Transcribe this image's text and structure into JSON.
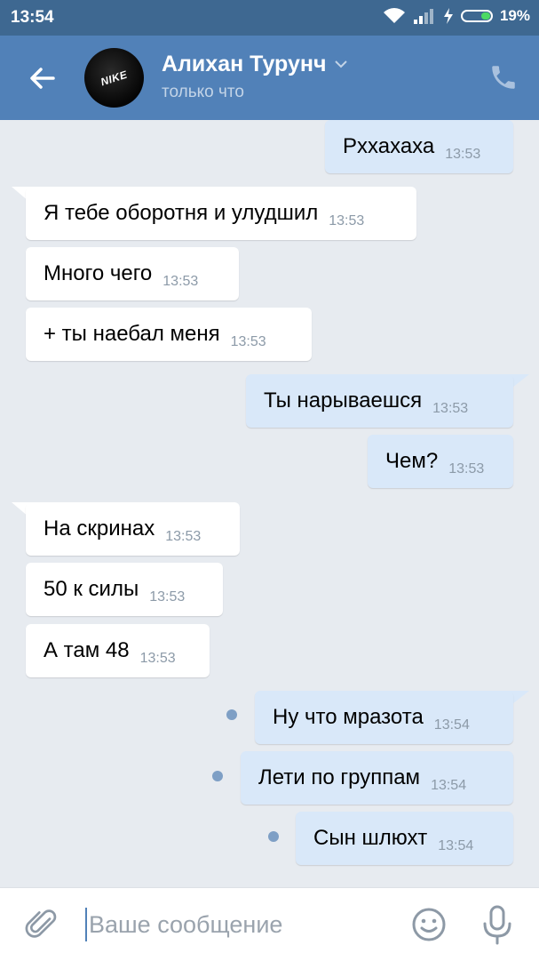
{
  "status_bar": {
    "time": "13:54",
    "battery": "19%"
  },
  "header": {
    "back_icon": "arrow-left-icon",
    "avatar_logo": "NIKE",
    "name": "Алихан Турунч",
    "status": "только что",
    "call_icon": "phone-icon"
  },
  "messages": [
    {
      "dir": "out",
      "text": "Рххахаха",
      "time": "13:53"
    },
    {
      "dir": "in",
      "text": "Я тебе оборотня и улудшил",
      "time": "13:53"
    },
    {
      "dir": "in",
      "text": "Много чего",
      "time": "13:53"
    },
    {
      "dir": "in",
      "text": "+ ты наебал меня",
      "time": "13:53"
    },
    {
      "dir": "out",
      "text": "Ты нарываешся",
      "time": "13:53"
    },
    {
      "dir": "out",
      "text": "Чем?",
      "time": "13:53"
    },
    {
      "dir": "in",
      "text": "На скринах",
      "time": "13:53"
    },
    {
      "dir": "in",
      "text": "50 к силы",
      "time": "13:53"
    },
    {
      "dir": "in",
      "text": "А там 48",
      "time": "13:53"
    },
    {
      "dir": "out",
      "text": "Ну что мразота",
      "time": "13:54",
      "unread": true
    },
    {
      "dir": "out",
      "text": "Лети по группам",
      "time": "13:54",
      "unread": true
    },
    {
      "dir": "out",
      "text": "Сын шлюхт",
      "time": "13:54",
      "unread": true
    }
  ],
  "composer": {
    "placeholder": "Ваше сообщение",
    "attach_icon": "paperclip-icon",
    "emoji_icon": "smile-icon",
    "voice_icon": "microphone-icon"
  },
  "colors": {
    "header": "#5181b8",
    "status_bar": "#3e6891",
    "background": "#e7ebf0",
    "incoming_bubble": "#ffffff",
    "outgoing_bubble": "#d9e8f9",
    "unread_dot": "#7e9fc5"
  }
}
